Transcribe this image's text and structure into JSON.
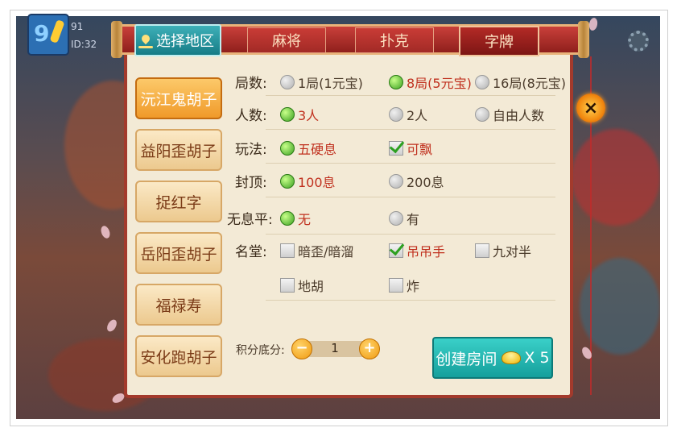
{
  "player": {
    "line1": "91",
    "line2": "ID:32"
  },
  "region_tab": "选择地区",
  "game_tabs": [
    "麻将",
    "扑克",
    "字牌"
  ],
  "close_glyph": "×",
  "regions": [
    "沅江鬼胡子",
    "益阳歪胡子",
    "捉红字",
    "岳阳歪胡子",
    "福禄寿",
    "安化跑胡子"
  ],
  "options": {
    "rounds": {
      "label": "局数:",
      "choices": [
        "1局(1元宝)",
        "8局(5元宝)",
        "16局(8元宝)"
      ],
      "selected": 1
    },
    "players": {
      "label": "人数:",
      "choices": [
        "3人",
        "2人",
        "自由人数"
      ],
      "selected": 0
    },
    "play": {
      "label": "玩法:",
      "choices": [
        "五硬息",
        "可飘"
      ]
    },
    "cap": {
      "label": "封顶:",
      "choices": [
        "100息",
        "200息"
      ],
      "selected": 0
    },
    "no_xi": {
      "label": "无息平:",
      "choices": [
        "无",
        "有"
      ],
      "selected": 0
    },
    "ming_tang": {
      "label": "名堂:",
      "choices": [
        "暗歪/暗溜",
        "吊吊手",
        "九对半",
        "地胡",
        "炸"
      ],
      "checked": [
        1
      ]
    }
  },
  "score": {
    "label": "积分底分:",
    "value": "1",
    "minus": "−",
    "plus": "+"
  },
  "create": {
    "label": "创建房间",
    "multiplier": "X 5"
  },
  "colors": {
    "accent": "#a33a2c",
    "teal": "#15a09c",
    "selected_text": "#c0301e"
  },
  "icons": [
    "location-pin-icon",
    "close-icon",
    "gold-ingot-icon",
    "gear-icon",
    "avatar-icon"
  ]
}
